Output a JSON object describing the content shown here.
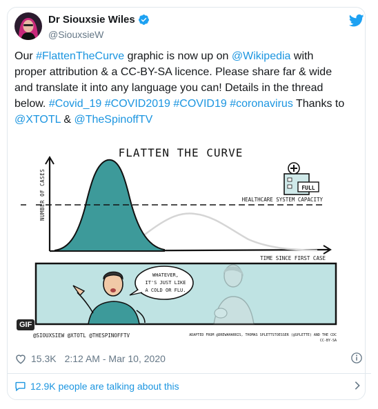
{
  "tweet": {
    "author_name": "Dr Siouxsie Wiles",
    "handle": "@SiouxsieW",
    "text_parts": [
      {
        "t": "Our ",
        "link": false
      },
      {
        "t": "#FlattenTheCurve",
        "link": true
      },
      {
        "t": " graphic is now up on ",
        "link": false
      },
      {
        "t": "@Wikipedia",
        "link": true
      },
      {
        "t": " with proper attribution & a CC-BY-SA licence.  Please share far & wide and translate it into any language you can! Details in the thread below. ",
        "link": false
      },
      {
        "t": "#Covid_19",
        "link": true
      },
      {
        "t": " ",
        "link": false
      },
      {
        "t": "#COVID2019",
        "link": true
      },
      {
        "t": " ",
        "link": false
      },
      {
        "t": "#COVID19",
        "link": true
      },
      {
        "t": " ",
        "link": false
      },
      {
        "t": "#coronavirus",
        "link": true
      },
      {
        "t": "  Thanks to ",
        "link": false
      },
      {
        "t": "@XTOTL",
        "link": true
      },
      {
        "t": " & ",
        "link": false
      },
      {
        "t": "@TheSpinoffTV",
        "link": true
      }
    ],
    "likes": "15.3K",
    "timestamp": "2:12 AM - Mar 10, 2020",
    "talking": "12.9K people are talking about this",
    "gif_label": "GIF"
  },
  "graphic": {
    "title": "FLATTEN THE CURVE",
    "ylabel": "NUMBER OF CASES",
    "xlabel": "TIME SINCE FIRST CASE",
    "capacity_label": "HEALTHCARE SYSTEM CAPACITY",
    "hospital_sign": "FULL",
    "speech": [
      "WHATEVER,",
      "IT'S JUST LIKE",
      "A COLD OR FLU."
    ],
    "credit_left": "@SIOUXSIEW @XTOTL @THESPINOFFTV",
    "credit_right_1": "ADAPTED FROM @DREWAHARRIS, THOMAS SPLETTSTOESSER (@SPLETTE) AND THE CDC",
    "credit_right_2": "CC-BY-SA"
  },
  "colors": {
    "link": "#1b95e0",
    "teal": "#3d9a9a",
    "panel": "#bfe3e3",
    "muted": "#657786"
  }
}
